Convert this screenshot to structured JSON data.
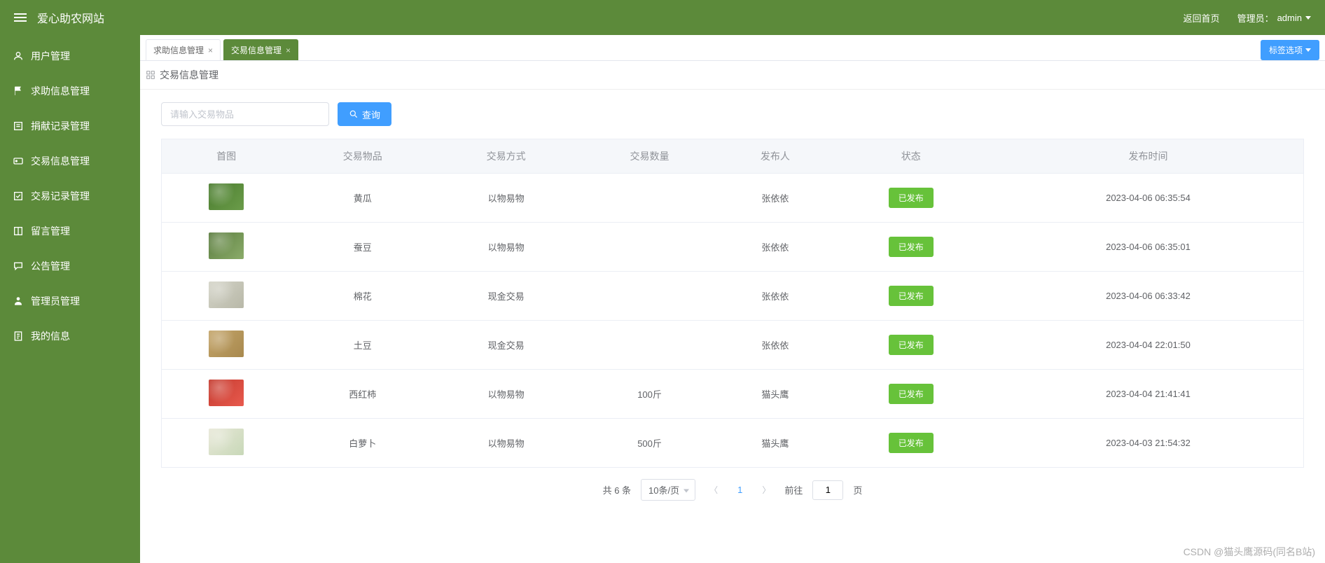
{
  "header": {
    "app_title": "爱心助农网站",
    "home_link": "返回首页",
    "admin_label": "管理员：",
    "admin_name": "admin"
  },
  "sidebar": {
    "items": [
      {
        "label": "用户管理",
        "icon": "user"
      },
      {
        "label": "求助信息管理",
        "icon": "flag"
      },
      {
        "label": "捐献记录管理",
        "icon": "list"
      },
      {
        "label": "交易信息管理",
        "icon": "card"
      },
      {
        "label": "交易记录管理",
        "icon": "check"
      },
      {
        "label": "留言管理",
        "icon": "book"
      },
      {
        "label": "公告管理",
        "icon": "chat"
      },
      {
        "label": "管理员管理",
        "icon": "admin"
      },
      {
        "label": "我的信息",
        "icon": "doc"
      }
    ]
  },
  "tabs": {
    "items": [
      {
        "label": "求助信息管理",
        "active": false
      },
      {
        "label": "交易信息管理",
        "active": true
      }
    ],
    "tag_options": "标签选项"
  },
  "breadcrumb": {
    "title": "交易信息管理"
  },
  "search": {
    "placeholder": "请输入交易物品",
    "button": "查询"
  },
  "table": {
    "headers": [
      "首图",
      "交易物品",
      "交易方式",
      "交易数量",
      "发布人",
      "状态",
      "发布时间"
    ],
    "rows": [
      {
        "item": "黄瓜",
        "method": "以物易物",
        "qty": "",
        "publisher": "张依依",
        "status": "已发布",
        "time": "2023-04-06 06:35:54",
        "thumb": "t1"
      },
      {
        "item": "蚕豆",
        "method": "以物易物",
        "qty": "",
        "publisher": "张依依",
        "status": "已发布",
        "time": "2023-04-06 06:35:01",
        "thumb": "t2"
      },
      {
        "item": "棉花",
        "method": "现金交易",
        "qty": "",
        "publisher": "张依依",
        "status": "已发布",
        "time": "2023-04-06 06:33:42",
        "thumb": "t3"
      },
      {
        "item": "土豆",
        "method": "现金交易",
        "qty": "",
        "publisher": "张依依",
        "status": "已发布",
        "time": "2023-04-04 22:01:50",
        "thumb": "t4"
      },
      {
        "item": "西红柿",
        "method": "以物易物",
        "qty": "100斤",
        "publisher": "猫头鹰",
        "status": "已发布",
        "time": "2023-04-04 21:41:41",
        "thumb": "t5"
      },
      {
        "item": "白萝卜",
        "method": "以物易物",
        "qty": "500斤",
        "publisher": "猫头鹰",
        "status": "已发布",
        "time": "2023-04-03 21:54:32",
        "thumb": "t6"
      }
    ]
  },
  "pagination": {
    "total_label": "共 6 条",
    "page_size": "10条/页",
    "current": "1",
    "goto_label": "前往",
    "page_suffix": "页",
    "goto_value": "1"
  },
  "watermark": "CSDN @猫头鹰源码(同名B站)"
}
